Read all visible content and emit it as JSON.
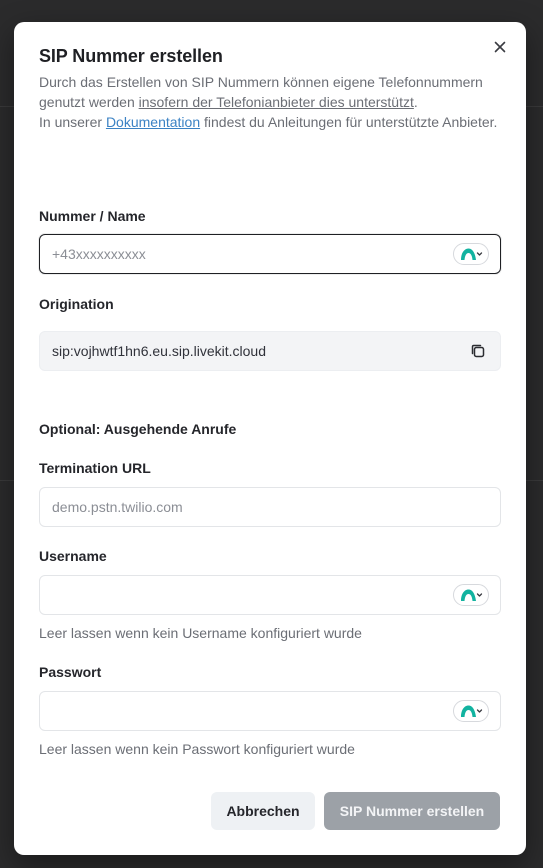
{
  "modal": {
    "title": "SIP Nummer erstellen",
    "description": {
      "part1": "Durch das Erstellen von SIP Nummern können eigene Telefonnummern genutzt werden ",
      "link1": "insofern der Telefonianbieter dies unterstützt",
      "part2": ".",
      "part3": "In unserer ",
      "link2": "Dokumentation",
      "part4": " findest du Anleitungen für unterstützte Anbieter."
    },
    "close_icon": "close-icon"
  },
  "form": {
    "number": {
      "label": "Nummer / Name",
      "value": "",
      "placeholder": "+43xxxxxxxxxx"
    },
    "origination": {
      "label": "Origination",
      "value": "sip:vojhwtf1hn6.eu.sip.livekit.cloud",
      "copy_icon": "copy-icon"
    },
    "optional_heading": "Optional: Ausgehende Anrufe",
    "termination_url": {
      "label": "Termination URL",
      "value": "",
      "placeholder": "demo.pstn.twilio.com"
    },
    "username": {
      "label": "Username",
      "value": "",
      "placeholder": "",
      "hint": "Leer lassen wenn kein Username konfiguriert wurde"
    },
    "password": {
      "label": "Passwort",
      "value": "",
      "placeholder": "",
      "hint": "Leer lassen wenn kein Passwort konfiguriert wurde"
    }
  },
  "actions": {
    "cancel_label": "Abbrechen",
    "submit_label": "SIP Nummer erstellen"
  },
  "colors": {
    "accent_teal": "#12b3a0",
    "submit_disabled": "#9ca1a7",
    "link_blue": "#3b82c4"
  }
}
